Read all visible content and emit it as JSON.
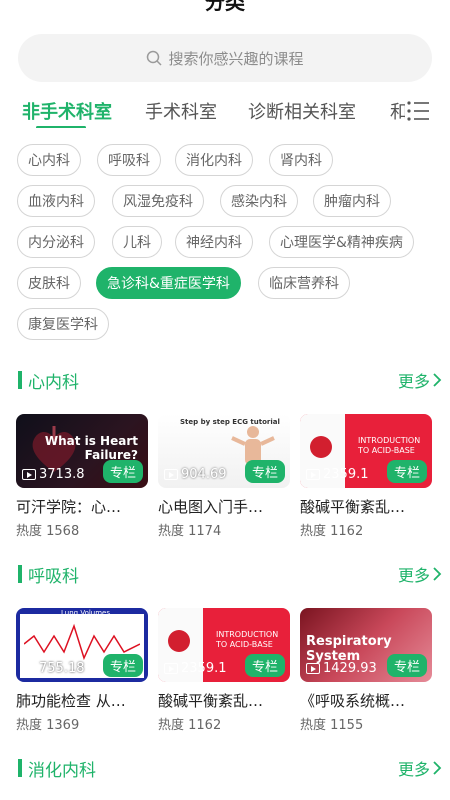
{
  "header": {
    "title": "分类"
  },
  "search": {
    "placeholder": "搜索你感兴趣的课程",
    "icon": "search-icon"
  },
  "tabs": [
    {
      "label": "非手术科室",
      "active": true
    },
    {
      "label": "手术科室",
      "active": false
    },
    {
      "label": "诊断相关科室",
      "active": false
    },
    {
      "label": "和",
      "active": false
    }
  ],
  "chips": [
    "心内科",
    "呼吸科",
    "消化内科",
    "肾内科",
    "血液内科",
    "风湿免疫科",
    "感染内科",
    "肿瘤内科",
    "内分泌科",
    "儿科",
    "神经内科",
    "心理医学&精神疾病",
    "皮肤科",
    "急诊科&重症医学科",
    "临床营养科",
    "康复医学科"
  ],
  "active_chip": "急诊科&重症医学科",
  "colors": {
    "accent": "#1fb36a"
  },
  "more_label": "更多",
  "sections": [
    {
      "title": "心内科",
      "cards": [
        {
          "thumb_text": "What is Heart Failure?",
          "plays": "3713.8",
          "badge": "专栏",
          "title": "可汗学院：心…",
          "heat": "热度 1568"
        },
        {
          "thumb_text": "Step by step ECG tutorial",
          "plays": "904.69",
          "badge": "专栏",
          "title": "心电图入门手…",
          "heat": "热度 1174"
        },
        {
          "thumb_text": "INTRODUCTION TO ACID-BASE",
          "plays": "2359.1",
          "badge": "专栏",
          "title": "酸碱平衡紊乱…",
          "heat": "热度 1162"
        }
      ]
    },
    {
      "title": "呼吸科",
      "cards": [
        {
          "thumb_text": "Lung Volumes",
          "plays": "755.18",
          "badge": "专栏",
          "title": "肺功能检查 从…",
          "heat": "热度 1369"
        },
        {
          "thumb_text": "INTRODUCTION TO ACID-BASE",
          "plays": "2359.1",
          "badge": "专栏",
          "title": "酸碱平衡紊乱…",
          "heat": "热度 1162"
        },
        {
          "thumb_text": "Respiratory System",
          "plays": "1429.93",
          "badge": "专栏",
          "title": "《呼吸系统概…",
          "heat": "热度 1155"
        }
      ]
    },
    {
      "title": "消化内科",
      "cards": []
    }
  ]
}
